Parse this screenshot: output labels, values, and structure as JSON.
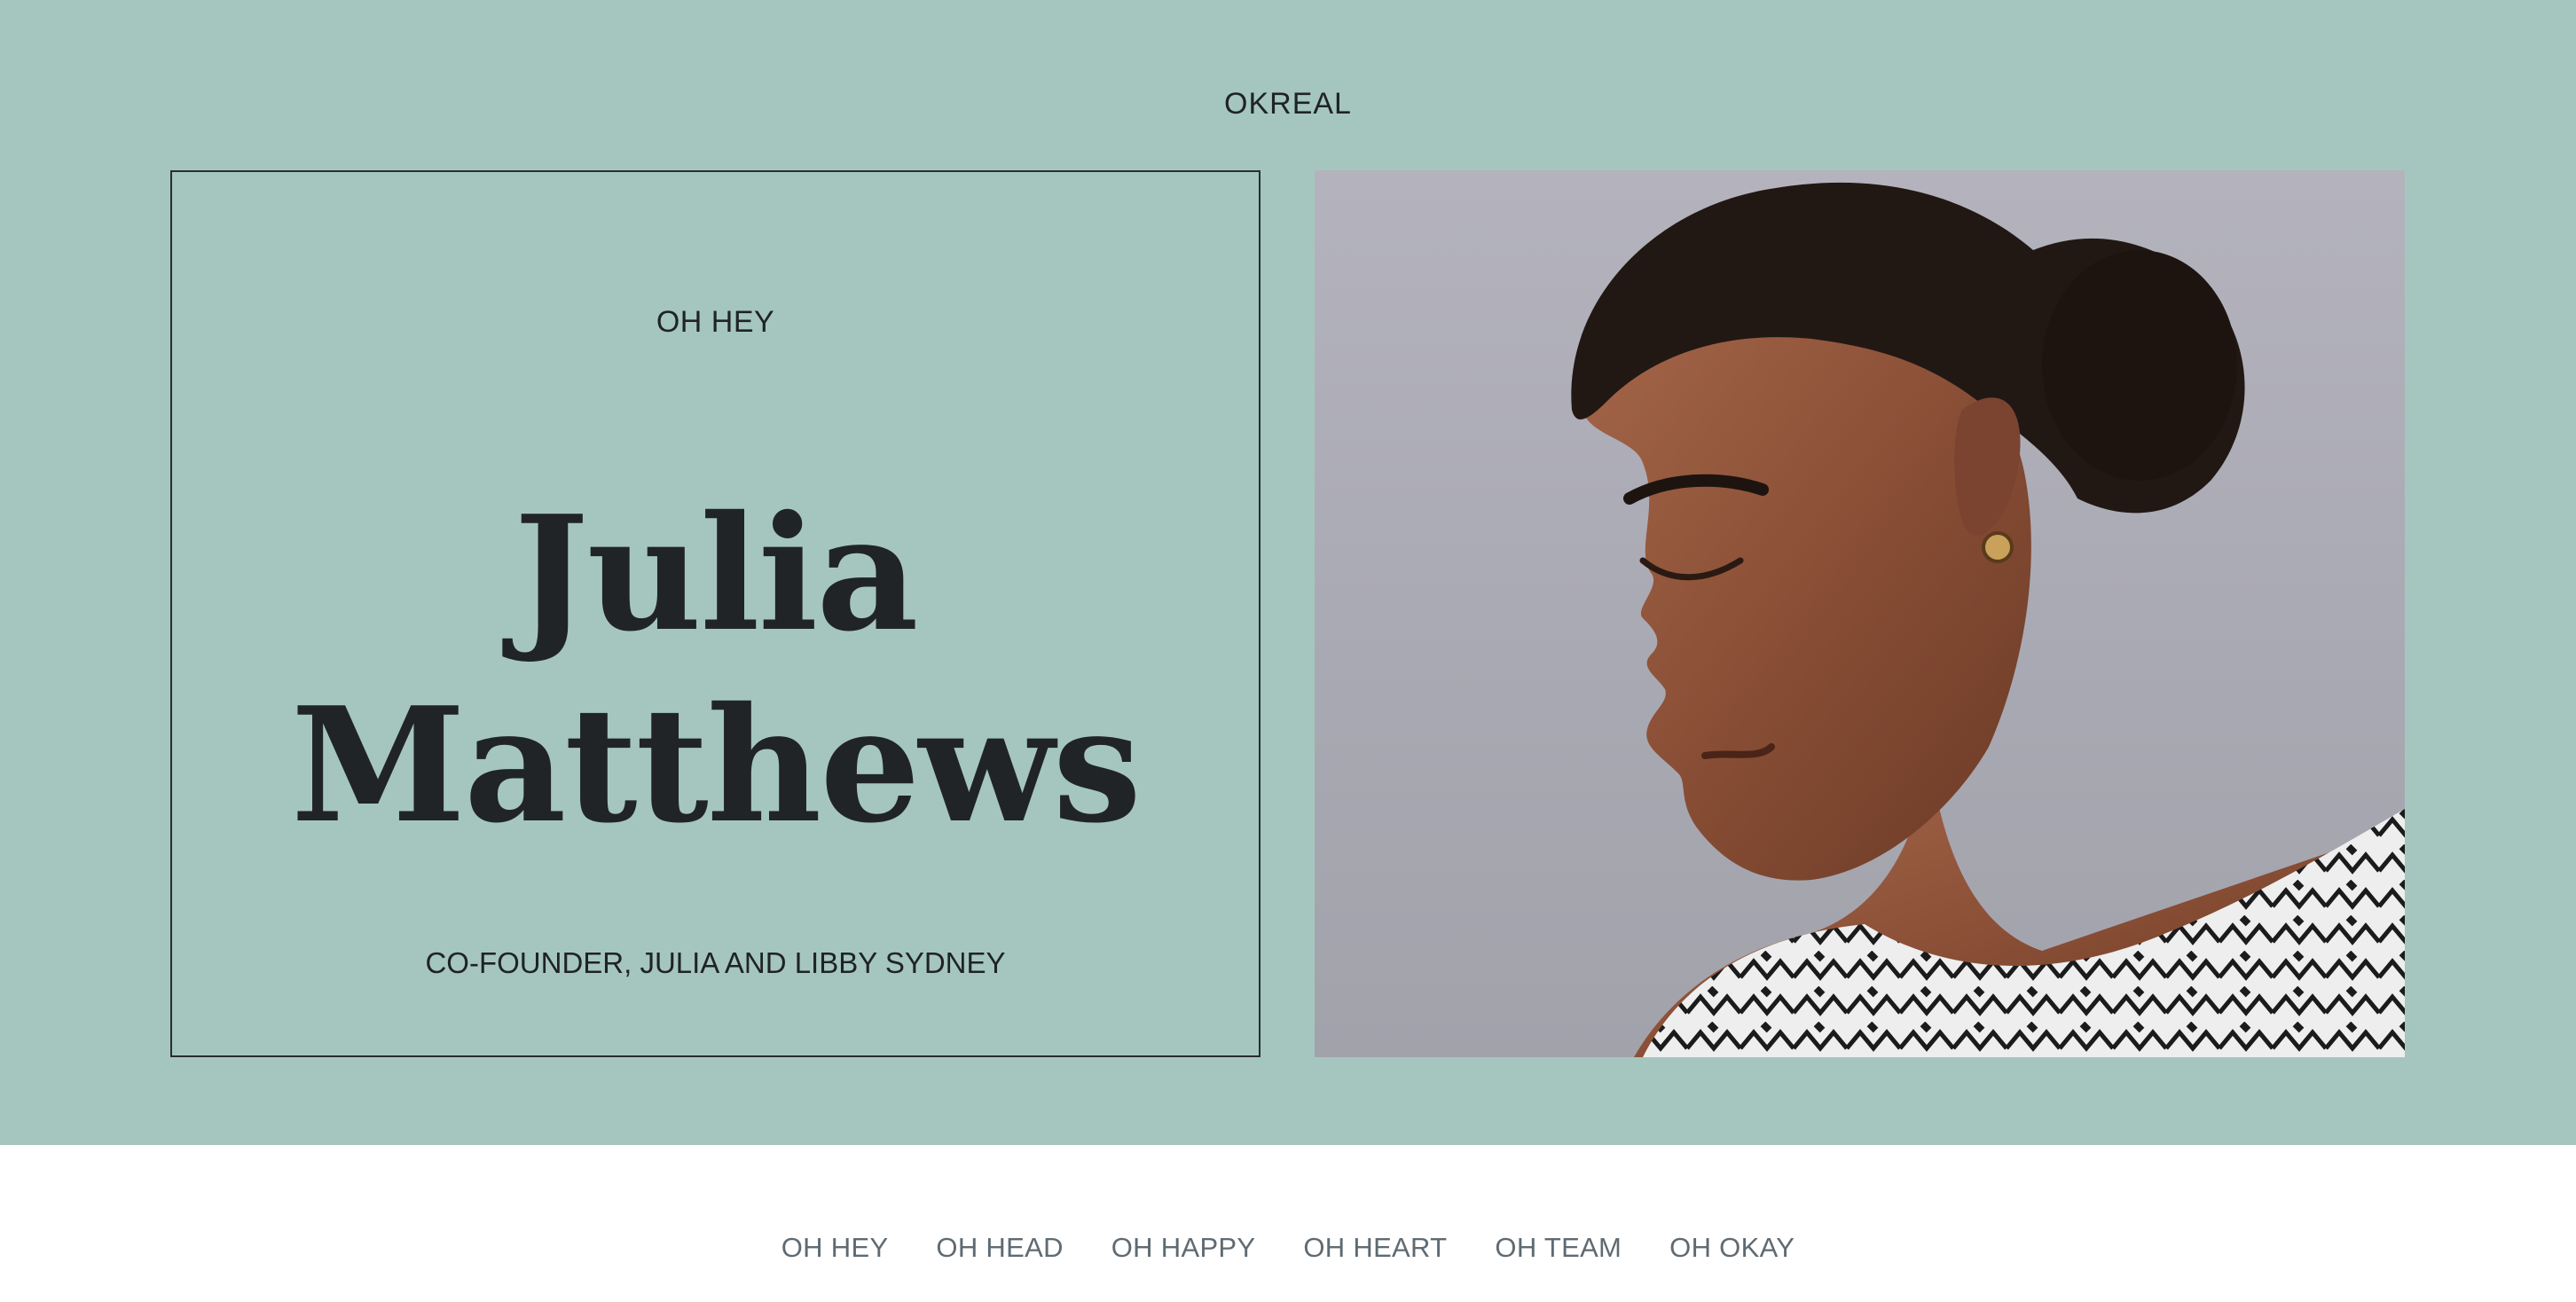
{
  "header": {
    "brand": "OKREAL"
  },
  "intro": {
    "greeting": "OH HEY",
    "name_line1": "Julia",
    "name_line2": "Matthews",
    "role": "CO-FOUNDER, JULIA AND LIBBY SYDNEY"
  },
  "portrait": {
    "icon": "profile-photo"
  },
  "nav": {
    "items": [
      {
        "label": "OH HEY"
      },
      {
        "label": "OH HEAD"
      },
      {
        "label": "OH HAPPY"
      },
      {
        "label": "OH HEART"
      },
      {
        "label": "OH TEAM"
      },
      {
        "label": "OH OKAY"
      }
    ]
  },
  "colors": {
    "hero_background": "#a5c6bf",
    "text_dark": "#212427",
    "nav_text": "#5f6a72"
  }
}
